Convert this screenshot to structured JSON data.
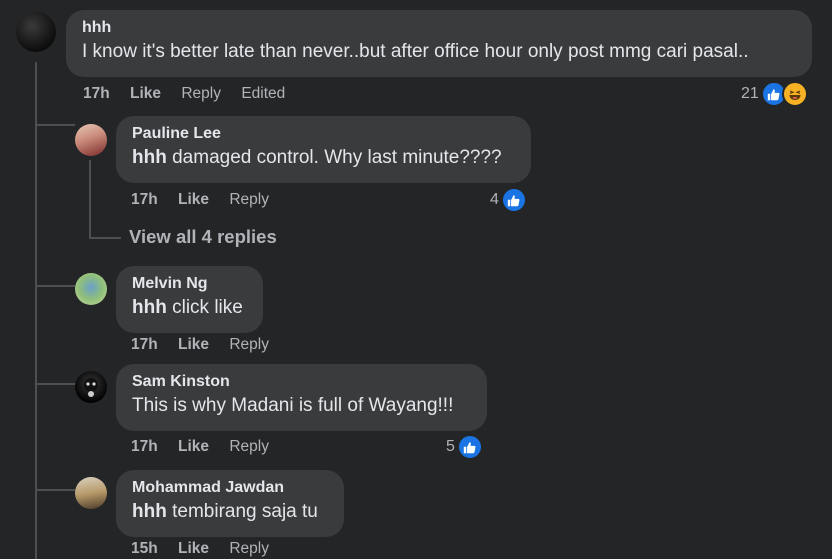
{
  "top_comment": {
    "author": "hhh",
    "text": "I know it's better late than never..but after office hour only post mmg cari pasal..",
    "time": "17h",
    "like_label": "Like",
    "reply_label": "Reply",
    "edited_label": "Edited",
    "reaction_count": "21"
  },
  "replies": [
    {
      "author": "Pauline Lee",
      "mention": "hhh",
      "text": " damaged control. Why last minute????",
      "time": "17h",
      "like_label": "Like",
      "reply_label": "Reply",
      "reaction_count": "4"
    },
    {
      "author": "Melvin Ng",
      "mention": "hhh",
      "text": " click like",
      "time": "17h",
      "like_label": "Like",
      "reply_label": "Reply"
    },
    {
      "author": "Sam Kinston",
      "mention": "",
      "text": "This is why Madani is full of Wayang!!!",
      "time": "17h",
      "like_label": "Like",
      "reply_label": "Reply",
      "reaction_count": "5"
    },
    {
      "author": "Mohammad Jawdan",
      "mention": "hhh",
      "text": " tembirang saja tu",
      "time": "15h",
      "like_label": "Like",
      "reply_label": "Reply"
    }
  ],
  "view_all_replies": "View all 4 replies",
  "colors": {
    "background": "#242526",
    "bubble": "#3a3b3c",
    "secondary_text": "#b0b3b8",
    "like_blue": "#1b74e4",
    "haha_yellow": "#f7b125"
  }
}
